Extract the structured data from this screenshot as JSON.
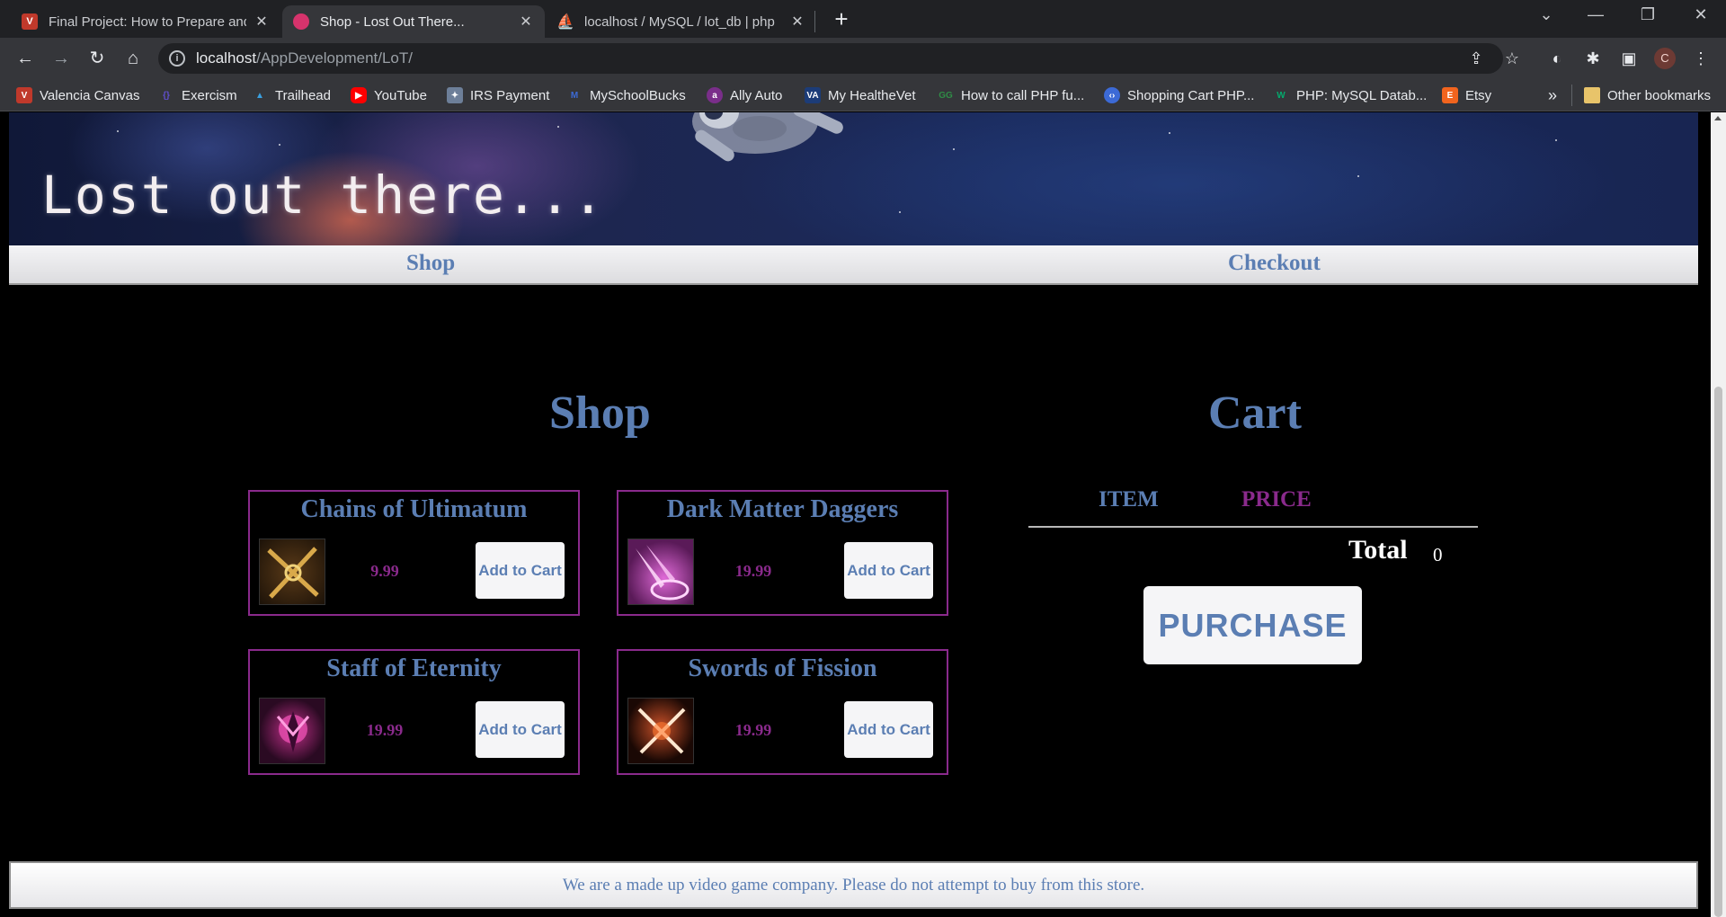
{
  "browser": {
    "tabs": [
      {
        "title": "Final Project: How to Prepare and",
        "favicon": "canvas-icon",
        "color": "#c0392b",
        "active": false
      },
      {
        "title": "Shop - Lost Out There...",
        "favicon": "shop-icon",
        "color": "#d6336c",
        "active": true
      },
      {
        "title": "localhost / MySQL / lot_db | php",
        "favicon": "phpmyadmin-icon",
        "color": "#f0a030",
        "active": false
      }
    ],
    "url_host": "localhost",
    "url_path": "/AppDevelopment/LoT/",
    "profile_initial": "C",
    "bookmarks": [
      {
        "label": "Valencia Canvas",
        "icon": "canvas-icon",
        "color": "#c0392b"
      },
      {
        "label": "Exercism",
        "icon": "exercism-icon",
        "color": "#604fcd"
      },
      {
        "label": "Trailhead",
        "icon": "trailhead-icon",
        "color": "#3aa0e0"
      },
      {
        "label": "YouTube",
        "icon": "youtube-icon",
        "color": "#ff0000"
      },
      {
        "label": "IRS Payment",
        "icon": "irs-icon",
        "color": "#6d7f99"
      },
      {
        "label": "MySchoolBucks",
        "icon": "myschoolbucks-icon",
        "color": "#3c6ad6"
      },
      {
        "label": "Ally Auto",
        "icon": "ally-icon",
        "color": "#7a2e8a"
      },
      {
        "label": "My HealtheVet",
        "icon": "va-icon",
        "color": "#1c3c78"
      },
      {
        "label": "How to call PHP fu...",
        "icon": "geeks-icon",
        "color": "#2f8d46"
      },
      {
        "label": "Shopping Cart PHP...",
        "icon": "code-icon",
        "color": "#3c6ad6"
      },
      {
        "label": "PHP: MySQL Datab...",
        "icon": "w3-icon",
        "color": "#04aa6d"
      },
      {
        "label": "Etsy",
        "icon": "etsy-icon",
        "color": "#f1641e"
      }
    ],
    "overflow_label": "»",
    "other_bookmarks_label": "Other bookmarks"
  },
  "site": {
    "banner_title": "Lost out there...",
    "nav": {
      "shop": "Shop",
      "checkout": "Checkout"
    }
  },
  "shop": {
    "title": "Shop",
    "add_label": "Add to Cart",
    "products": [
      {
        "name": "Chains of Ultimatum",
        "price": "9.99",
        "image": "chains-icon"
      },
      {
        "name": "Dark Matter Daggers",
        "price": "19.99",
        "image": "daggers-icon"
      },
      {
        "name": "Staff of Eternity",
        "price": "19.99",
        "image": "staff-icon"
      },
      {
        "name": "Swords of Fission",
        "price": "19.99",
        "image": "swords-icon"
      }
    ]
  },
  "cart": {
    "title": "Cart",
    "col_item": "ITEM",
    "col_price": "PRICE",
    "total_label": "Total",
    "total_value": "0",
    "purchase_label": "PURCHASE"
  },
  "footer": {
    "text": "We are a made up video game company. Please do not attempt to buy from this store."
  },
  "colors": {
    "accent_blue": "#5b7eb3",
    "accent_purple": "#8a2a8c",
    "background": "#000000"
  }
}
